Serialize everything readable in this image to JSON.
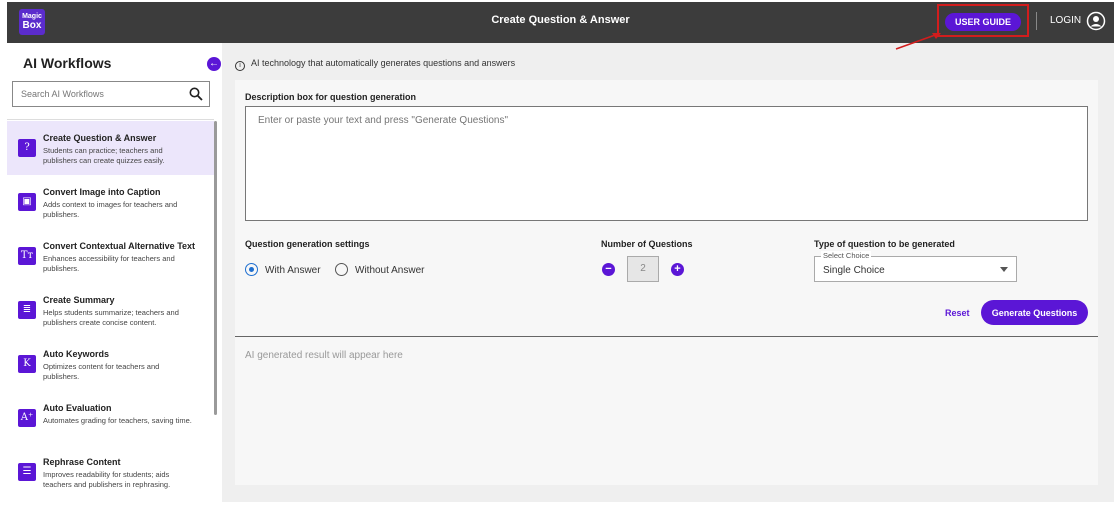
{
  "header": {
    "logo_line1": "Magic",
    "logo_line2": "Box",
    "title": "Create Question & Answer",
    "user_guide_label": "USER GUIDE",
    "login_label": "LOGIN"
  },
  "sidebar": {
    "title": "AI Workflows",
    "search_placeholder": "Search AI Workflows",
    "items": [
      {
        "icon": "?",
        "icon_name": "question-icon",
        "name": "Create Question & Answer",
        "desc": "Students can practice; teachers and publishers can create quizzes easily.",
        "active": true
      },
      {
        "icon": "▣",
        "icon_name": "image-caption-icon",
        "name": "Convert Image into Caption",
        "desc": "Adds context to images for teachers and publishers.",
        "active": false
      },
      {
        "icon": "Tт",
        "icon_name": "alt-text-icon",
        "name": "Convert Contextual Alternative Text",
        "desc": "Enhances accessibility for teachers and publishers.",
        "active": false
      },
      {
        "icon": "≣",
        "icon_name": "summary-icon",
        "name": "Create Summary",
        "desc": "Helps students summarize; teachers and publishers create concise content.",
        "active": false
      },
      {
        "icon": "K",
        "icon_name": "keywords-icon",
        "name": "Auto Keywords",
        "desc": "Optimizes content for teachers and publishers.",
        "active": false
      },
      {
        "icon": "A⁺",
        "icon_name": "evaluation-icon",
        "name": "Auto Evaluation",
        "desc": "Automates grading for teachers, saving time.",
        "active": false
      },
      {
        "icon": "☰",
        "icon_name": "rephrase-icon",
        "name": "Rephrase Content",
        "desc": "Improves readability for students; aids teachers and publishers in rephrasing.",
        "active": false
      }
    ]
  },
  "main": {
    "info_text": "AI technology that automatically generates questions and answers",
    "desc_label": "Description box for question generation",
    "desc_placeholder": "Enter or paste your text and press \"Generate Questions\"",
    "settings_label": "Question generation settings",
    "radio_with_answer": "With Answer",
    "radio_without_answer": "Without Answer",
    "selected_mode": "With Answer",
    "num_questions_label": "Number of Questions",
    "num_questions_value": "2",
    "type_label": "Type of question to be generated",
    "select_legend": "Select Choice",
    "select_value": "Single Choice",
    "reset_label": "Reset",
    "generate_label": "Generate Questions",
    "result_placeholder": "AI generated result will appear here"
  },
  "colors": {
    "accent": "#5b16d6",
    "topbar": "#3c3c3c",
    "highlight_box": "#d21d1d",
    "active_item_bg": "#ece6fb"
  }
}
